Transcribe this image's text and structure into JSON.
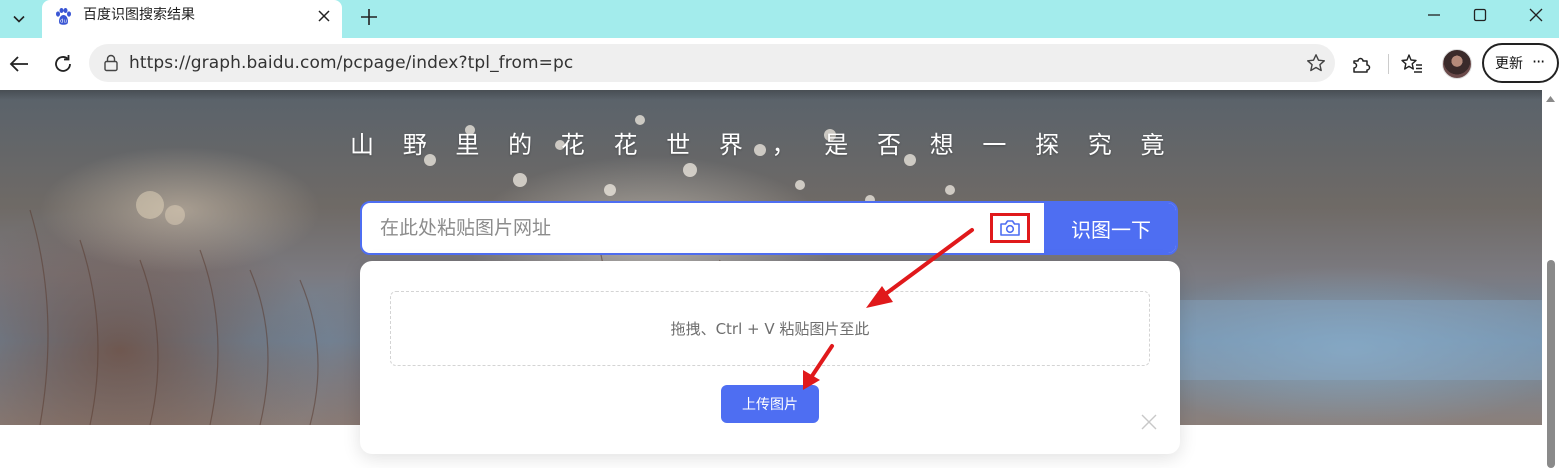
{
  "browser": {
    "tab": {
      "title": "百度识图搜索结果",
      "favicon": "baidu-paw-icon"
    },
    "url": "https://graph.baidu.com/pcpage/index?tpl_from=pc",
    "update_label": "更新",
    "update_more": "···",
    "colors": {
      "tabstrip": "#a3ecec",
      "omnibox": "#efefef"
    }
  },
  "hero": {
    "headline": "山野里的花花世界，是否想一探究竟"
  },
  "search": {
    "placeholder": "在此处粘贴图片网址",
    "camera_icon": "camera-icon",
    "button_label": "识图一下",
    "accent": "#4e6ef2"
  },
  "upload": {
    "dropzone_text": "拖拽、Ctrl + V 粘贴图片至此",
    "button_label": "上传图片"
  },
  "annotations": {
    "highlight_color": "#e0191b",
    "arrow_color": "#e0191b"
  }
}
